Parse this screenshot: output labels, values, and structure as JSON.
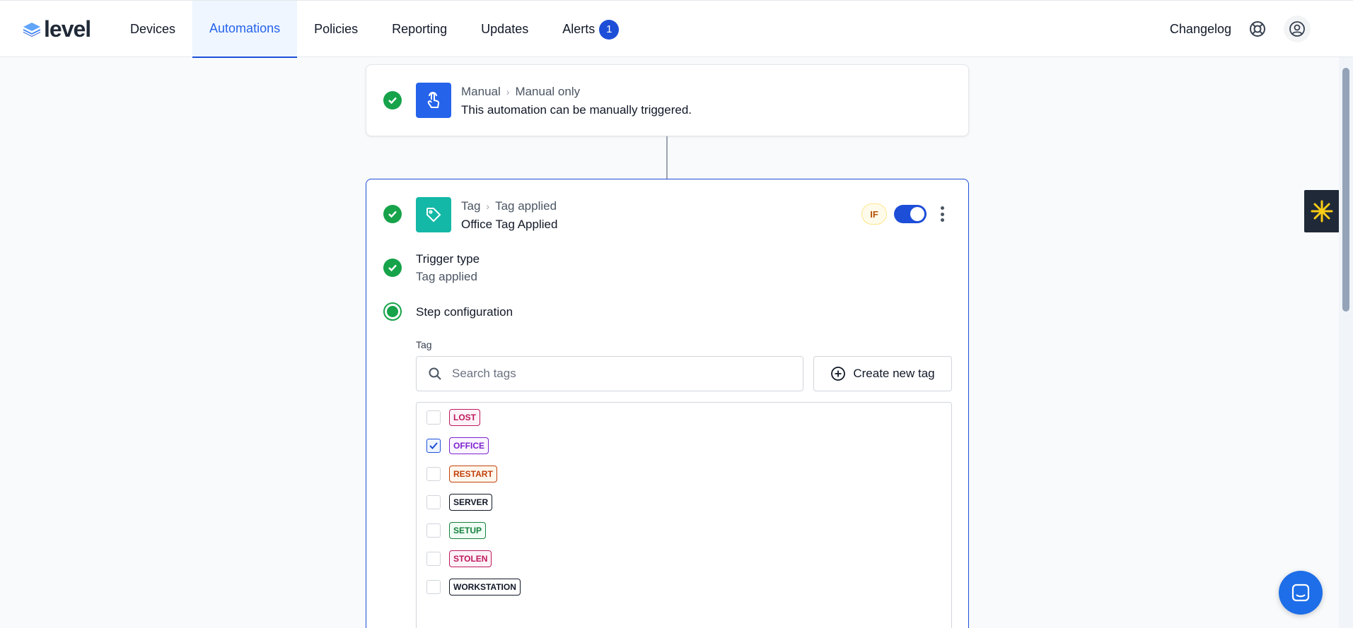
{
  "header": {
    "logo_text": "level",
    "nav": [
      {
        "label": "Devices"
      },
      {
        "label": "Automations",
        "active": true
      },
      {
        "label": "Policies"
      },
      {
        "label": "Reporting"
      },
      {
        "label": "Updates"
      },
      {
        "label": "Alerts",
        "badge": "1"
      }
    ],
    "changelog_label": "Changelog"
  },
  "trigger_card": {
    "icon": "pointer-hand-icon",
    "crumb_category": "Manual",
    "crumb_item": "Manual only",
    "description": "This automation can be manually triggered."
  },
  "tag_card": {
    "icon": "tag-icon",
    "crumb_category": "Tag",
    "crumb_item": "Tag applied",
    "title": "Office Tag Applied",
    "if_badge": "IF",
    "enabled": true,
    "trigger_type_label": "Trigger type",
    "trigger_type_value": "Tag applied",
    "step_config_label": "Step configuration",
    "tag_field_label": "Tag",
    "search_placeholder": "Search tags",
    "create_tag_label": "Create new tag",
    "tags": [
      {
        "name": "LOST",
        "checked": false,
        "color": "#be185d",
        "bg": "#fdf2f8"
      },
      {
        "name": "OFFICE",
        "checked": true,
        "color": "#7e22ce",
        "bg": "#faf5ff"
      },
      {
        "name": "RESTART",
        "checked": false,
        "color": "#c2410c",
        "bg": "#fff7ed"
      },
      {
        "name": "SERVER",
        "checked": false,
        "color": "#111827",
        "bg": "#ffffff"
      },
      {
        "name": "SETUP",
        "checked": false,
        "color": "#15803d",
        "bg": "#f0fdf4"
      },
      {
        "name": "STOLEN",
        "checked": false,
        "color": "#be185d",
        "bg": "#fdf2f8"
      },
      {
        "name": "WORKSTATION",
        "checked": false,
        "color": "#111827",
        "bg": "#ffffff"
      }
    ]
  },
  "colors": {
    "accent": "#1d4ed8",
    "success": "#16a34a",
    "trigger_icon_bg": "#2563eb",
    "tag_icon_bg": "#14b8a6"
  }
}
